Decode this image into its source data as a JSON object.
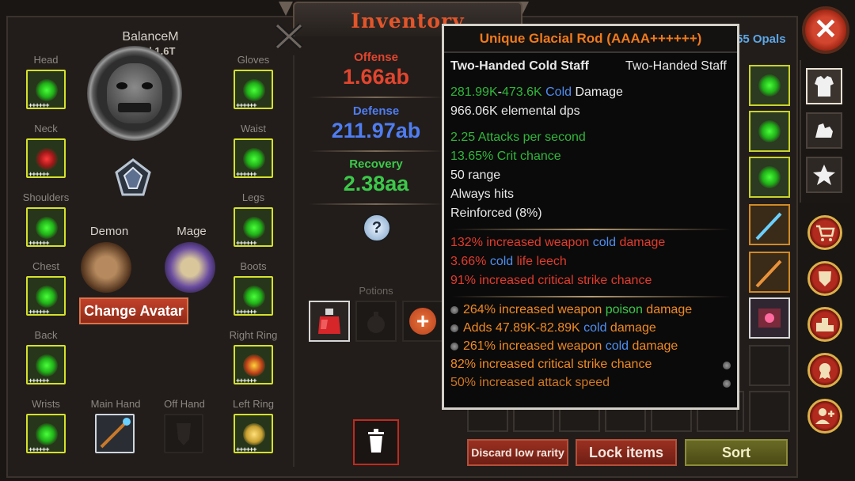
{
  "header": {
    "title": "Inventory"
  },
  "character": {
    "name": "BalanceM",
    "level": "Level 1.6T",
    "avatar_icon": "skull-mask-icon",
    "class_left": "Demon",
    "class_right": "Mage",
    "change_avatar_label": "Change Avatar"
  },
  "slots": {
    "head": "Head",
    "neck": "Neck",
    "shoulders": "Shoulders",
    "chest": "Chest",
    "back": "Back",
    "wrists": "Wrists",
    "main_hand": "Main Hand",
    "off_hand": "Off Hand",
    "left_ring": "Left Ring",
    "gloves": "Gloves",
    "waist": "Waist",
    "legs": "Legs",
    "boots": "Boots",
    "right_ring": "Right Ring",
    "plus_marks": "++++++"
  },
  "stats": {
    "offense_label": "Offense",
    "offense_value": "1.66ab",
    "defense_label": "Defense",
    "defense_value": "211.97ab",
    "recovery_label": "Recovery",
    "recovery_value": "2.38aa",
    "help_label": "?"
  },
  "potions": {
    "label": "Potions",
    "add_label": "+"
  },
  "currency": {
    "opals": "55 Opals"
  },
  "buttons": {
    "discard": "Discard low rarity",
    "lock": "Lock items",
    "sort": "Sort",
    "close": "✕"
  },
  "tooltip": {
    "name": "Unique Glacial Rod (AAAA++++++)",
    "type_left": "Two-Handed Cold Staff",
    "type_right": "Two-Handed Staff",
    "damage_low": "281.99K",
    "damage_sep": "-",
    "damage_high": "473.6K",
    "damage_elem": "Cold",
    "damage_word": "Damage",
    "dps": "966.06K elemental dps",
    "attacks": "2.25 Attacks per second",
    "crit": "13.65% Crit chance",
    "range": "50 range",
    "always_hits": "Always hits",
    "reinforced": "Reinforced (8%)",
    "implicit": [
      {
        "a": "132% increased weapon ",
        "b": "cold",
        "c": " damage"
      },
      {
        "a": "3.66% ",
        "b": "cold",
        "c": " life leech"
      },
      {
        "a": "91% increased critical strike chance",
        "b": "",
        "c": ""
      }
    ],
    "mods": [
      {
        "a": "264% increased weapon ",
        "b": "poison",
        "c": " damage",
        "color": "green"
      },
      {
        "a": "Adds 47.89K-82.89K ",
        "b": "cold",
        "c": " damage",
        "color": "blue"
      },
      {
        "a": "261% increased weapon ",
        "b": "cold",
        "c": " damage",
        "color": "blue"
      },
      {
        "a": "82% increased critical strike chance",
        "b": "",
        "c": "",
        "color": ""
      },
      {
        "a": "50% increased attack speed",
        "b": "",
        "c": "",
        "color": ""
      }
    ]
  },
  "side_tabs": [
    "armor-icon",
    "strength-arm-icon",
    "star-icon"
  ],
  "round_buttons": [
    "cart-icon",
    "shield-icon",
    "podium-icon",
    "medal-icon",
    "add-friend-icon"
  ]
}
